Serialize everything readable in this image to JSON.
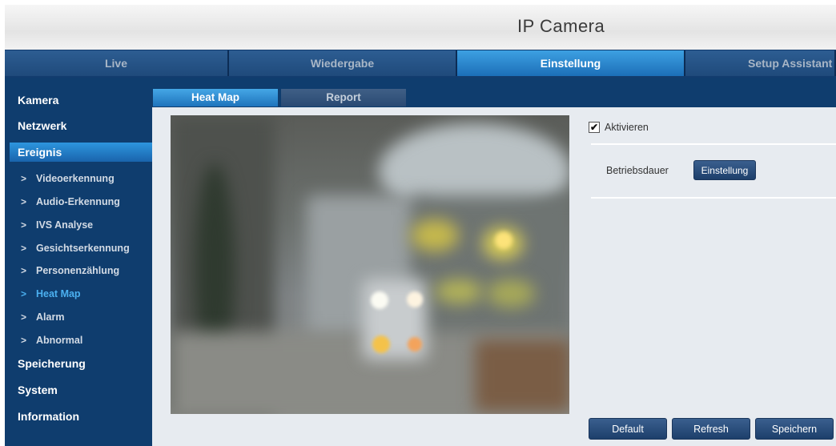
{
  "header": {
    "title": "IP Camera"
  },
  "topnav": {
    "tabs": [
      {
        "label": "Live",
        "active": false
      },
      {
        "label": "Wiedergabe",
        "active": false
      },
      {
        "label": "Einstellung",
        "active": true
      },
      {
        "label": "Setup Assistant",
        "active": false
      }
    ]
  },
  "sidebar": {
    "kamera": "Kamera",
    "netzwerk": "Netzwerk",
    "ereignis": "Ereignis",
    "sub_items": [
      "Videoerkennung",
      "Audio-Erkennung",
      "IVS Analyse",
      "Gesichtserkennung",
      "Personenzählung",
      "Heat Map",
      "Alarm",
      "Abnormal"
    ],
    "speicherung": "Speicherung",
    "system": "System",
    "information": "Information",
    "arrow_glyph": ">"
  },
  "subtabs": {
    "heatmap": "Heat Map",
    "report": "Report"
  },
  "settings": {
    "enable_label": "Aktivieren",
    "enable_checked": true,
    "check_glyph": "✔",
    "betriebsdauer_label": "Betriebsdauer",
    "einstellung_button": "Einstellung"
  },
  "buttons": {
    "default": "Default",
    "refresh": "Refresh",
    "save": "Speichern"
  },
  "colors": {
    "nav_dark": "#0f3d6e",
    "accent_active": "#2d95de",
    "content_bg": "#e7ebf0"
  }
}
